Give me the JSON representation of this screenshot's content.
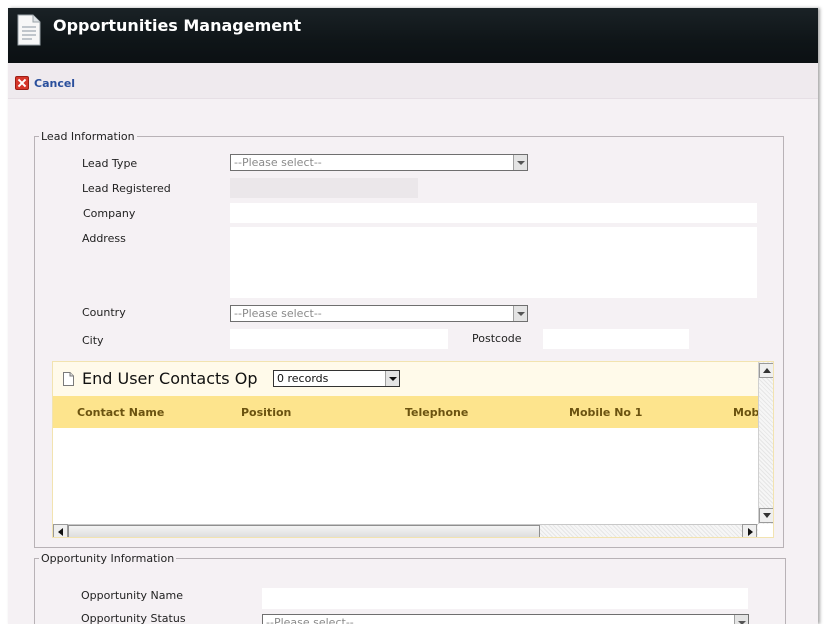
{
  "window": {
    "title": "Opportunities Management"
  },
  "toolbar": {
    "cancel_label": "Cancel"
  },
  "lead_information": {
    "legend": "Lead Information",
    "lead_type_label": "Lead Type",
    "lead_type_value": "--Please select--",
    "lead_registered_label": "Lead Registered",
    "company_label": "Company",
    "address_label": "Address",
    "country_label": "Country",
    "country_value": "--Please select--",
    "city_label": "City",
    "postcode_label": "Postcode"
  },
  "contacts_grid": {
    "title": "End User Contacts Op",
    "records_value": "0 records",
    "columns": [
      "Contact Name",
      "Position",
      "Telephone",
      "Mobile No 1",
      "Mob"
    ]
  },
  "opportunity_information": {
    "legend": "Opportunity Information",
    "opportunity_name_label": "Opportunity Name",
    "opportunity_status_label": "Opportunity Status",
    "opportunity_status_value": "--Please select--"
  },
  "colors": {
    "titlebar": "#0f1518",
    "grid_header": "#fde48d",
    "cancel_link": "#2a4f9c"
  },
  "icons": {
    "title": "document-icon",
    "cancel": "cancel-icon",
    "grid": "document-icon"
  }
}
